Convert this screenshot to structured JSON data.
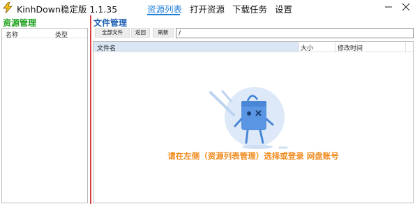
{
  "app": {
    "title": "KinhDown稳定版 1.1.35",
    "icon": "lightning-bolt-icon"
  },
  "nav": {
    "tabs": [
      {
        "label": "资源列表",
        "active": true
      },
      {
        "label": "打开资源",
        "active": false
      },
      {
        "label": "下载任务",
        "active": false
      },
      {
        "label": "设置",
        "active": false
      }
    ]
  },
  "window_controls": {
    "minimize_icon": "minimize-icon",
    "close_icon": "close-icon"
  },
  "left_panel": {
    "heading": "资源管理",
    "columns": [
      "名称",
      "类型"
    ]
  },
  "right_panel": {
    "heading": "文件管理",
    "toolbar": {
      "all_files": "全部文件",
      "back": "返回",
      "refresh": "刷新"
    },
    "path_value": "/",
    "columns": {
      "name": "文件名",
      "size": "大小",
      "modified": "修改时间"
    },
    "empty_message": "请在左侧（资源列表管理）选择或登录 网盘账号"
  },
  "colors": {
    "accent": "#1e7fd8",
    "left_heading": "#1aa01a",
    "right_heading": "#1e5fb4",
    "divider": "#d93c3c",
    "empty_message": "#f08a1c"
  }
}
